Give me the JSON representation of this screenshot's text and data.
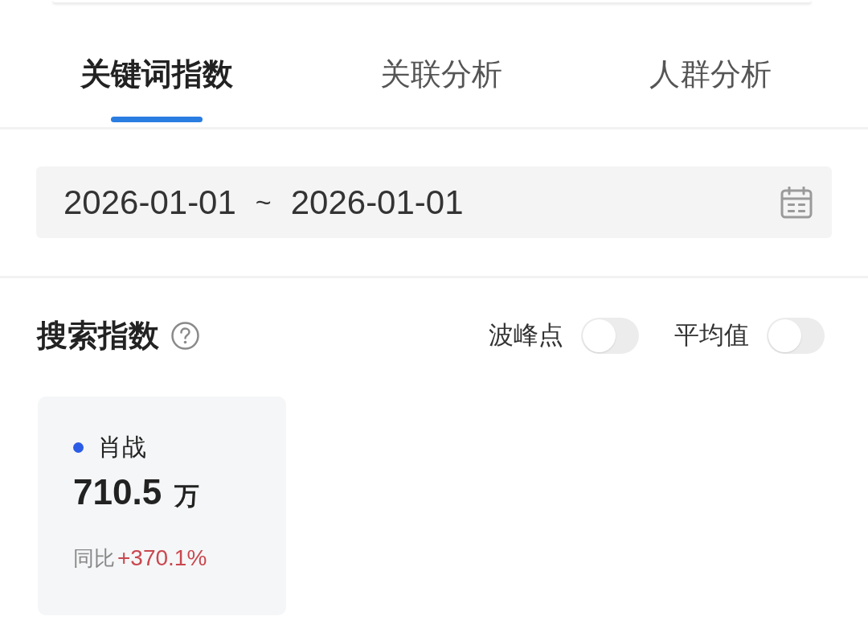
{
  "tabs": [
    {
      "label": "关键词指数",
      "selected": true
    },
    {
      "label": "关联分析",
      "selected": false
    },
    {
      "label": "人群分析",
      "selected": false
    }
  ],
  "date_range": {
    "start": "2026-01-01",
    "separator": "~",
    "end": "2026-01-01"
  },
  "section": {
    "title": "搜索指数",
    "toggles": [
      {
        "label": "波峰点",
        "on": false
      },
      {
        "label": "平均值",
        "on": false
      }
    ]
  },
  "cards": [
    {
      "name": "肖战",
      "color": "#2b5ce6",
      "value": "710.5",
      "unit": "万",
      "change_label": "同比",
      "change": "+370.1%"
    }
  ]
}
